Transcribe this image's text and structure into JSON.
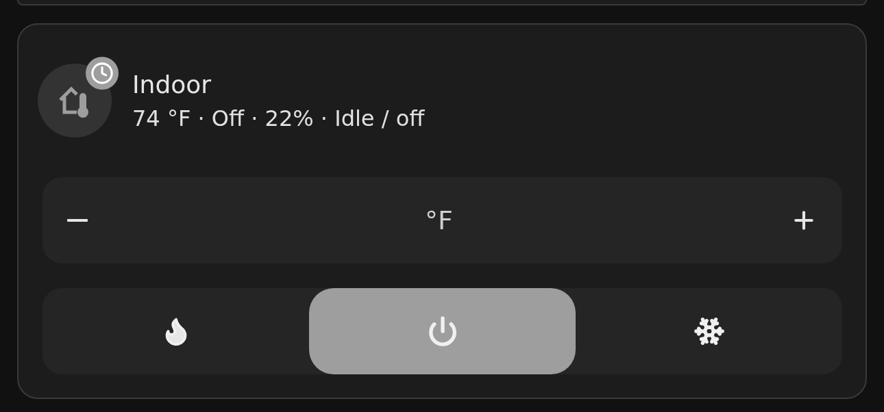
{
  "card": {
    "title": "Indoor",
    "status": "74 °F · Off · 22% · Idle / off",
    "scheduled": true
  },
  "stepper": {
    "unit": "°F"
  },
  "modes": [
    {
      "kind": "heat",
      "selected": false
    },
    {
      "kind": "off",
      "selected": true
    },
    {
      "kind": "cool",
      "selected": false
    }
  ]
}
